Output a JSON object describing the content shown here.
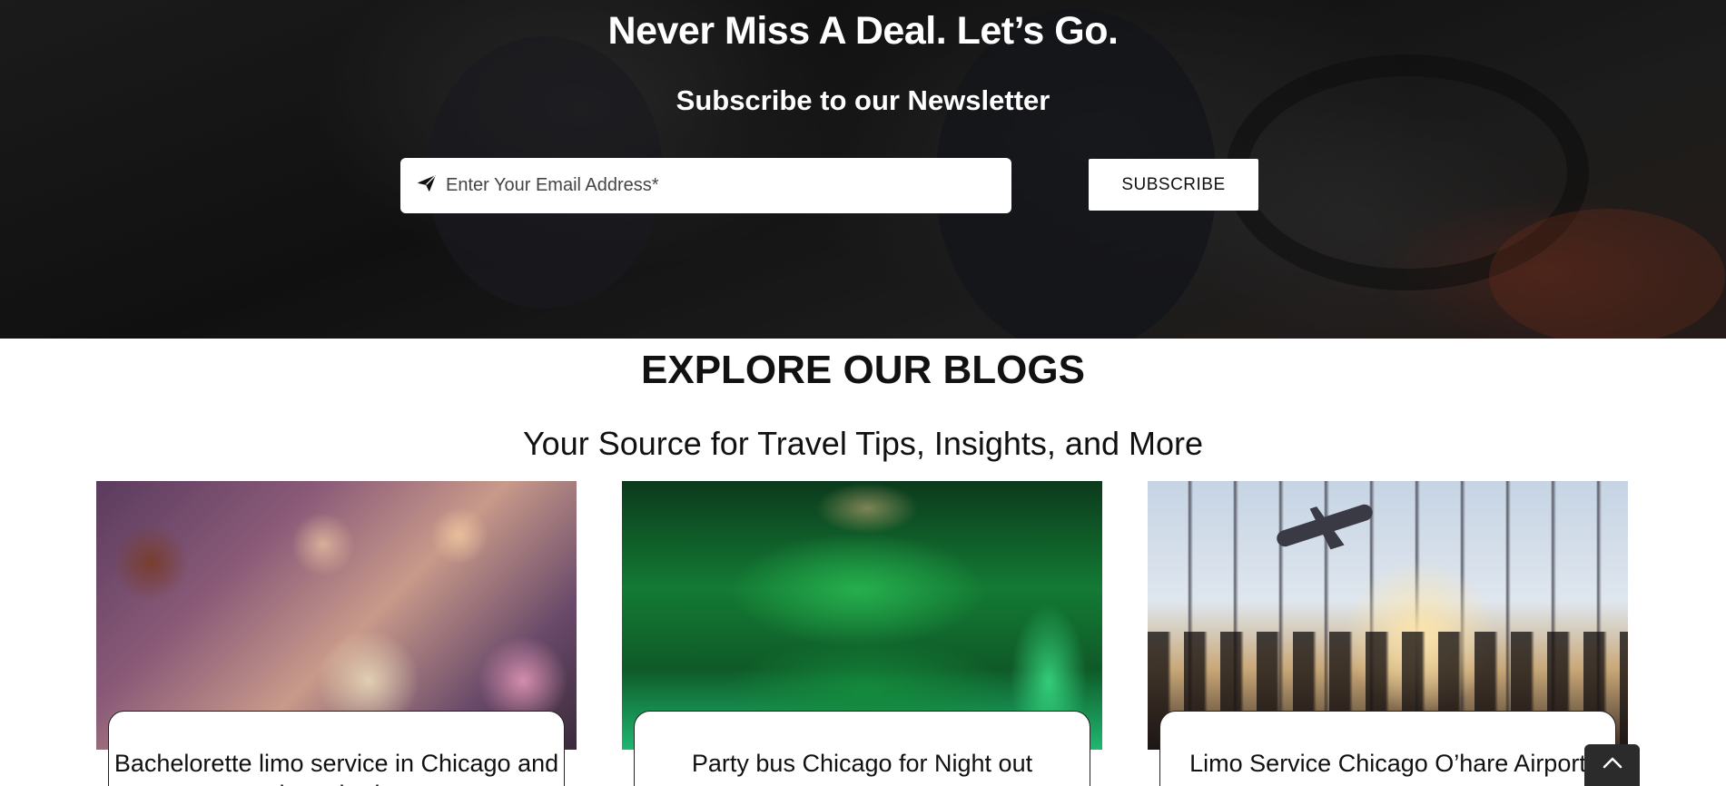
{
  "newsletter": {
    "title": "Never Miss A Deal. Let’s Go.",
    "subtitle": "Subscribe to our Newsletter",
    "email_placeholder": "Enter Your Email Address*",
    "email_icon": "paper-plane-icon",
    "subscribe_label": "SUBSCRIBE"
  },
  "blogs": {
    "title": "EXPLORE OUR BLOGS",
    "subtitle": "Your Source for Travel Tips, Insights, and More",
    "cards": [
      {
        "title": "Bachelorette limo service in Chicago and the suburbs",
        "image": "bachelorette-party-limo-photo"
      },
      {
        "title": "Party bus Chicago for Night out",
        "image": "green-party-bus-interior-photo"
      },
      {
        "title": "Limo Service Chicago O’hare Airport",
        "image": "airport-terminal-travelers-photo"
      }
    ]
  },
  "scroll_top": {
    "icon": "chevron-up-icon"
  }
}
